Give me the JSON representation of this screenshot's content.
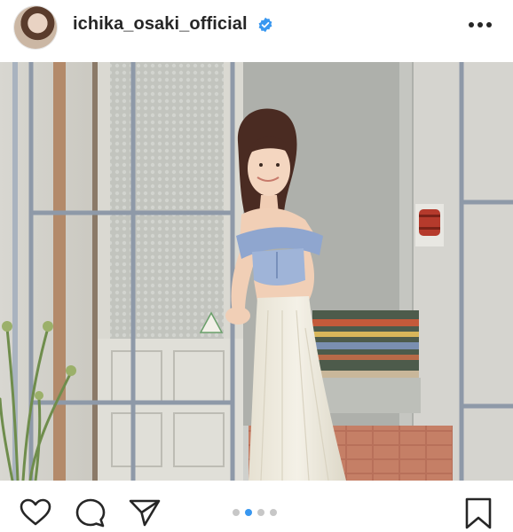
{
  "post": {
    "username": "ichika_osaki_official",
    "verified": true,
    "carousel": {
      "count": 4,
      "active_index": 1
    }
  },
  "icons": {
    "avatar": "profile-avatar",
    "verified": "verified-badge-icon",
    "more": "more-options-icon",
    "like": "heart-icon",
    "comment": "comment-icon",
    "share": "paper-plane-icon",
    "save": "bookmark-icon"
  },
  "colors": {
    "text": "#262626",
    "verified_blue": "#3897f0",
    "dot_active": "#3897f0",
    "dot_inactive": "#c7c7c7"
  }
}
